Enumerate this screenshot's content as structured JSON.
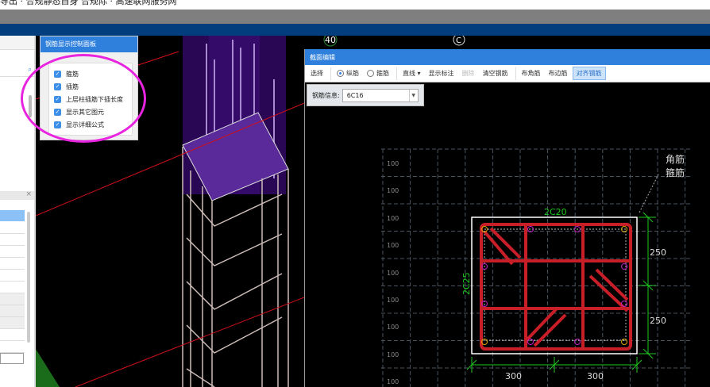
{
  "top_strip": {
    "text": "导出  ·  合规静态自身 合规际   ·   高速联网服务网"
  },
  "canvas": {
    "axis_label_40": "40",
    "axis_label_c": "C"
  },
  "control_panel": {
    "title": "钢筋显示控制面板",
    "options": [
      {
        "label": "箍筋",
        "checked": true
      },
      {
        "label": "插筋",
        "checked": true
      },
      {
        "label": "上层柱插筋下插长度",
        "checked": true
      },
      {
        "label": "显示其它图元",
        "checked": true
      },
      {
        "label": "显示详细公式",
        "checked": true
      }
    ]
  },
  "section_editor": {
    "title": "截面编辑",
    "toolbar": {
      "select": "选择",
      "radio_longitudinal": "纵筋",
      "radio_stirrup": "箍筋",
      "line": "直线",
      "show_annotation": "显示标注",
      "delete": "删除",
      "clear_rebar": "清空钢筋",
      "corner_rebar": "布角筋",
      "edge_rebar": "布边筋",
      "align_rebar": "对齐钢筋"
    },
    "rebar_info_label": "钢筋信息:",
    "rebar_info_value": "6C16",
    "drawing": {
      "grid_labels": [
        "100",
        "100",
        "100",
        "100",
        "100",
        "100",
        "100",
        "100",
        "100"
      ],
      "top_rebar": "2C20",
      "side_rebar": "2C25",
      "legend_corner": "角筋",
      "legend_stirrup": "箍筋",
      "dim_right": [
        "250",
        "250"
      ],
      "dim_bottom": [
        "300",
        "300"
      ]
    }
  }
}
